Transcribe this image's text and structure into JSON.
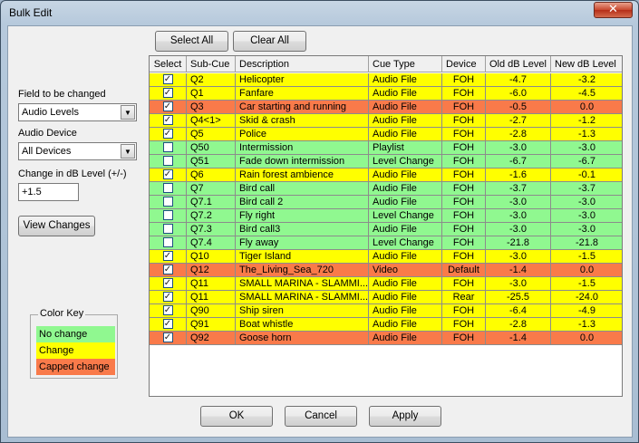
{
  "window": {
    "title": "Bulk Edit",
    "close_glyph": "✕"
  },
  "toolbar": {
    "select_all": "Select All",
    "clear_all": "Clear All"
  },
  "left": {
    "field_label": "Field to be changed",
    "field_value": "Audio Levels",
    "device_label": "Audio Device",
    "device_value": "All Devices",
    "change_label": "Change in dB Level (+/-)",
    "change_value": "+1.5",
    "view_changes": "View Changes"
  },
  "color_key": {
    "title": "Color Key",
    "items": [
      {
        "label": "No change",
        "color": "#90f890"
      },
      {
        "label": "Change",
        "color": "#ffff00"
      },
      {
        "label": "Capped change",
        "color": "#f97a4a"
      }
    ]
  },
  "colors": {
    "none": "#90f890",
    "change": "#ffff00",
    "capped": "#f97a4a"
  },
  "table": {
    "headers": [
      "Select",
      "Sub-Cue",
      "Description",
      "Cue Type",
      "Device",
      "Old dB Level",
      "New dB Level"
    ],
    "rows": [
      {
        "checked": true,
        "cue": "Q2",
        "desc": "Helicopter",
        "type": "Audio File",
        "device": "FOH",
        "old": "-4.7",
        "new": "-3.2",
        "status": "change"
      },
      {
        "checked": true,
        "cue": "Q1",
        "desc": "Fanfare",
        "type": "Audio File",
        "device": "FOH",
        "old": "-6.0",
        "new": "-4.5",
        "status": "change"
      },
      {
        "checked": true,
        "cue": "Q3",
        "desc": "Car starting and running",
        "type": "Audio File",
        "device": "FOH",
        "old": "-0.5",
        "new": "0.0",
        "status": "capped"
      },
      {
        "checked": true,
        "cue": "Q4<1>",
        "desc": "Skid & crash",
        "type": "Audio File",
        "device": "FOH",
        "old": "-2.7",
        "new": "-1.2",
        "status": "change"
      },
      {
        "checked": true,
        "cue": "Q5",
        "desc": "Police",
        "type": "Audio File",
        "device": "FOH",
        "old": "-2.8",
        "new": "-1.3",
        "status": "change"
      },
      {
        "checked": false,
        "cue": "Q50",
        "desc": "Intermission",
        "type": "Playlist",
        "device": "FOH",
        "old": "-3.0",
        "new": "-3.0",
        "status": "none"
      },
      {
        "checked": false,
        "cue": "Q51",
        "desc": "Fade down intermission",
        "type": "Level Change",
        "device": "FOH",
        "old": "-6.7",
        "new": "-6.7",
        "status": "none"
      },
      {
        "checked": true,
        "cue": "Q6",
        "desc": "Rain forest ambience",
        "type": "Audio File",
        "device": "FOH",
        "old": "-1.6",
        "new": "-0.1",
        "status": "change"
      },
      {
        "checked": false,
        "cue": "Q7",
        "desc": "Bird call",
        "type": "Audio File",
        "device": "FOH",
        "old": "-3.7",
        "new": "-3.7",
        "status": "none"
      },
      {
        "checked": false,
        "cue": "Q7.1",
        "desc": "Bird call 2",
        "type": "Audio File",
        "device": "FOH",
        "old": "-3.0",
        "new": "-3.0",
        "status": "none"
      },
      {
        "checked": false,
        "cue": "Q7.2",
        "desc": "Fly right",
        "type": "Level Change",
        "device": "FOH",
        "old": "-3.0",
        "new": "-3.0",
        "status": "none"
      },
      {
        "checked": false,
        "cue": "Q7.3",
        "desc": "Bird call3",
        "type": "Audio File",
        "device": "FOH",
        "old": "-3.0",
        "new": "-3.0",
        "status": "none"
      },
      {
        "checked": false,
        "cue": "Q7.4",
        "desc": "Fly away",
        "type": "Level Change",
        "device": "FOH",
        "old": "-21.8",
        "new": "-21.8",
        "status": "none"
      },
      {
        "checked": true,
        "cue": "Q10",
        "desc": "Tiger Island",
        "type": "Audio File",
        "device": "FOH",
        "old": "-3.0",
        "new": "-1.5",
        "status": "change"
      },
      {
        "checked": true,
        "cue": "Q12",
        "desc": "The_Living_Sea_720",
        "type": "Video",
        "device": "Default",
        "old": "-1.4",
        "new": "0.0",
        "status": "capped"
      },
      {
        "checked": true,
        "cue": "Q11",
        "desc": "SMALL MARINA - SLAMMI...",
        "type": "Audio File",
        "device": "FOH",
        "old": "-3.0",
        "new": "-1.5",
        "status": "change"
      },
      {
        "checked": true,
        "cue": "Q11",
        "desc": "SMALL MARINA - SLAMMI...",
        "type": "Audio File",
        "device": "Rear",
        "old": "-25.5",
        "new": "-24.0",
        "status": "change"
      },
      {
        "checked": true,
        "cue": "Q90",
        "desc": "Ship siren",
        "type": "Audio File",
        "device": "FOH",
        "old": "-6.4",
        "new": "-4.9",
        "status": "change"
      },
      {
        "checked": true,
        "cue": "Q91",
        "desc": "Boat whistle",
        "type": "Audio File",
        "device": "FOH",
        "old": "-2.8",
        "new": "-1.3",
        "status": "change"
      },
      {
        "checked": true,
        "cue": "Q92",
        "desc": "Goose horn",
        "type": "Audio File",
        "device": "FOH",
        "old": "-1.4",
        "new": "0.0",
        "status": "capped"
      }
    ]
  },
  "footer": {
    "ok": "OK",
    "cancel": "Cancel",
    "apply": "Apply"
  }
}
